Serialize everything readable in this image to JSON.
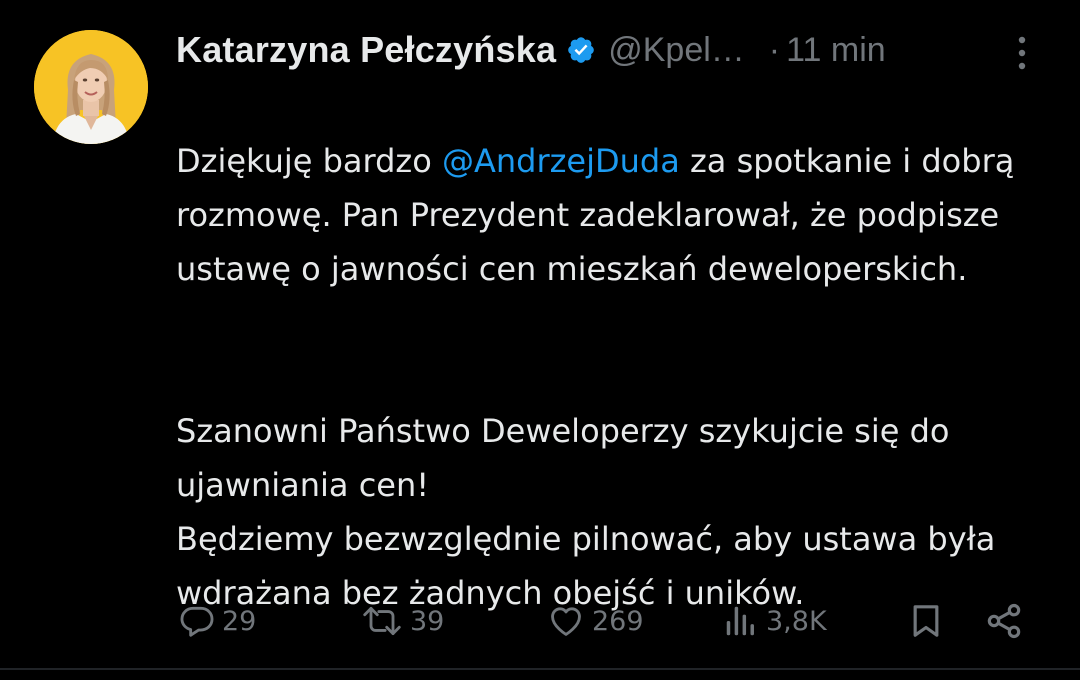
{
  "tweet": {
    "author": {
      "display_name": "Katarzyna Pełczyńska",
      "handle": "@Kpel…",
      "verified": true,
      "avatar_bg": "#f7c325"
    },
    "separator": "·",
    "time": "11 min",
    "text": {
      "p1_before": "Dziękuję bardzo ",
      "p1_mention": "@AndrzejDuda",
      "p1_after": " za spotkanie i dobrą rozmowę. Pan Prezydent zadeklarował, że podpisze ustawę o jawności cen mieszkań deweloperskich.",
      "p2": "Szanowni Państwo Deweloperzy szykujcie się do ujawniania cen!\nBędziemy bezwzględnie pilnować, aby ustawa była wdrażana bez żadnych obejść i uników."
    },
    "actions": {
      "replies": "29",
      "retweets": "39",
      "likes": "269",
      "views": "3,8K"
    }
  },
  "icons": {
    "verified": "verified-badge-icon",
    "more": "more-vertical-icon",
    "reply": "reply-icon",
    "retweet": "retweet-icon",
    "like": "heart-icon",
    "views": "views-chart-icon",
    "bookmark": "bookmark-icon",
    "share": "share-icon"
  },
  "colors": {
    "background": "#000000",
    "text": "#e7e9ea",
    "secondary": "#71767b",
    "accent": "#1d9bf0"
  }
}
